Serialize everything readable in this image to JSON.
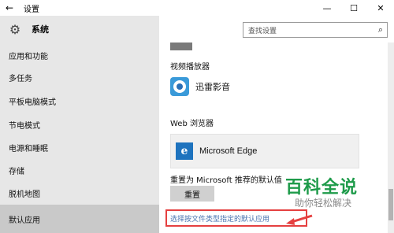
{
  "window": {
    "title": "设置",
    "back": "←",
    "minimize": "—",
    "maximize": "☐",
    "close": "✕"
  },
  "sidebar": {
    "header": {
      "icon": "gear-icon",
      "title": "系统"
    },
    "items": [
      {
        "label": "应用和功能"
      },
      {
        "label": "多任务"
      },
      {
        "label": "平板电脑模式"
      },
      {
        "label": "节电模式"
      },
      {
        "label": "电源和睡眠"
      },
      {
        "label": "存储"
      },
      {
        "label": "脱机地图"
      },
      {
        "label": "默认应用",
        "active": true
      }
    ]
  },
  "search": {
    "placeholder": "查找设置",
    "icon": "search-icon"
  },
  "main": {
    "video_player": {
      "label": "视频播放器",
      "app": "迅雷影音",
      "icon": "xunlei-player-icon"
    },
    "web_browser": {
      "label": "Web 浏览器",
      "app": "Microsoft Edge",
      "icon": "edge-icon",
      "icon_glyph": "e"
    },
    "reset": {
      "label": "重置为 Microsoft 推荐的默认值",
      "button": "重置"
    },
    "link": "选择按文件类型指定的默认应用"
  },
  "watermark": {
    "title": "百科全说",
    "subtitle": "助你轻松解决"
  },
  "colors": {
    "sidebar_bg": "#e7e7e7",
    "active_bg": "#c9c9c9",
    "edge_blue": "#1e73be",
    "highlight_red": "#e54040",
    "link_blue": "#4a74b0",
    "watermark_green": "#1e9b4a"
  }
}
